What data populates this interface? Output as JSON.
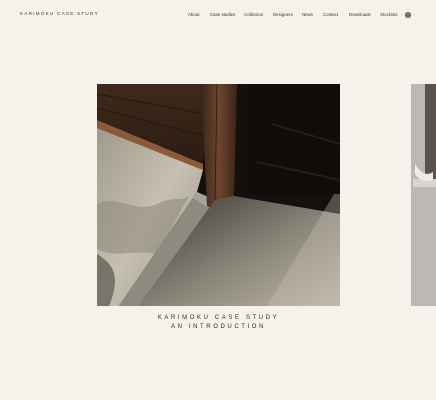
{
  "header": {
    "logo": "KARIMOKU CASE STUDY",
    "nav": [
      "About",
      "Case studies",
      "Collection",
      "Designers",
      "News",
      "Contact",
      "Downloads",
      "Stockists"
    ],
    "language_icon": "globe-icon"
  },
  "main": {
    "title_line1": "KARIMOKU CASE STUDY",
    "title_line2": "AN INTRODUCTION"
  },
  "colors": {
    "background": "#f6f1ea",
    "text": "#2e2a26"
  }
}
